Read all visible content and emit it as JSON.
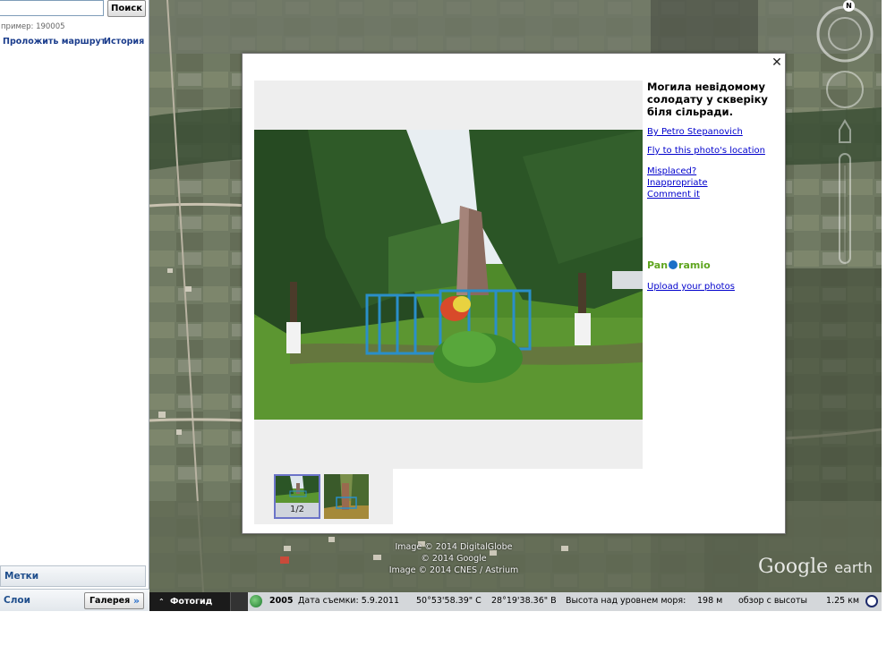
{
  "search": {
    "placeholder": "",
    "button_label": "Поиск",
    "hint": "пример: 190005"
  },
  "sidebar": {
    "route_link": "Проложить маршрут",
    "history_link": "История",
    "places_label": "Метки",
    "layers_label": "Слои",
    "gallery_label": "Галерея",
    "gallery_chevron": "»"
  },
  "map": {
    "compass_letter": "N",
    "credits": [
      "Image © 2014 DigitalGlobe",
      "© 2014 Google",
      "Image © 2014 CNES / Astrium"
    ],
    "logo_google": "Google",
    "logo_earth": "earth"
  },
  "statusbar": {
    "photoguide_label": "Фотогид",
    "photoguide_arrow": "⌃",
    "year": "2005",
    "capture_date": "Дата съемки: 5.9.2011",
    "latitude": "50°53'58.39\" С",
    "longitude": "28°19'38.36\" В",
    "elevation_label": "Высота над уровнем моря:",
    "elevation_value": "198 м",
    "eye_alt_label": "обзор с высоты",
    "eye_alt_value": "1.25 км"
  },
  "popup": {
    "close_symbol": "✕",
    "title": "Могила невідомому солодату у скверіку біля сільради.",
    "author_link": "By Petro Stepanovich",
    "fly_link": "Fly to this photo's location",
    "misplaced_link": "Misplaced?",
    "inappropriate_link": "Inappropriate",
    "comment_link": "Comment it",
    "logo_left": "Pan",
    "logo_right": "ramio",
    "upload_link": "Upload your photos",
    "thumb_count": "1/2"
  },
  "colors": {
    "link": "#0000cc",
    "sidebar_link": "#1a3c8c",
    "panoramio_green": "#5fa51f",
    "statusbar_dark": "#1b1b1b"
  }
}
